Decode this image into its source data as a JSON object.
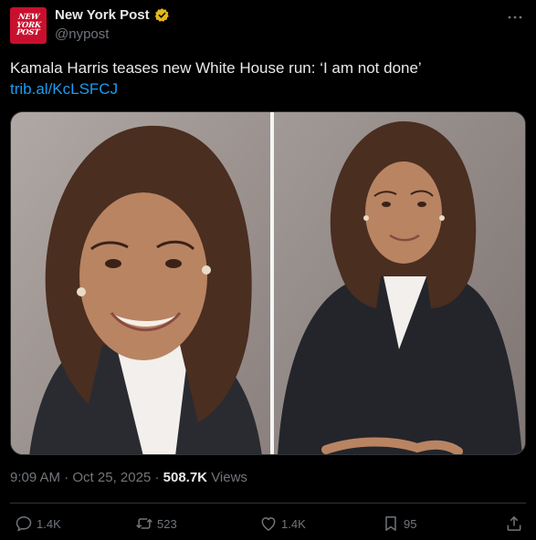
{
  "account": {
    "display_name": "New York Post",
    "handle": "@nypost",
    "avatar_lines": [
      "NEW",
      "YORK",
      "POST"
    ]
  },
  "tweet": {
    "text": "Kamala Harris teases new White House run: ‘I am not done’",
    "link": "trib.al/KcLSFCJ"
  },
  "meta": {
    "time": "9:09 AM",
    "separator": "·",
    "date": "Oct 25, 2025",
    "views_count": "508.7K",
    "views_label": "Views"
  },
  "actions": {
    "replies": "1.4K",
    "reposts": "523",
    "likes": "1.4K",
    "bookmarks": "95"
  },
  "colors": {
    "background": "#000000",
    "text": "#e7e9ea",
    "muted": "#71767b",
    "link": "#1d9bf0",
    "verified_gold": "#e2b719",
    "brand_red": "#c8102e"
  },
  "icons": [
    "verified-badge-icon",
    "more-icon",
    "reply-icon",
    "repost-icon",
    "like-icon",
    "bookmark-icon",
    "share-icon"
  ]
}
